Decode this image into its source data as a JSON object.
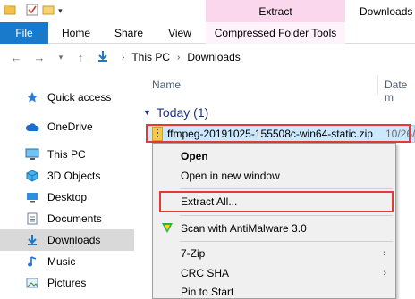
{
  "titlebar": {
    "context_group": "Extract",
    "window_title": "Downloads"
  },
  "ribbon": {
    "tabs": [
      "File",
      "Home",
      "Share",
      "View",
      "Compressed Folder Tools"
    ]
  },
  "address": {
    "crumbs": [
      "This PC",
      "Downloads"
    ]
  },
  "sidebar": {
    "items": [
      {
        "label": "Quick access",
        "icon": "star-icon"
      },
      {
        "label": "OneDrive",
        "icon": "cloud-icon"
      },
      {
        "label": "This PC",
        "icon": "computer-icon"
      },
      {
        "label": "3D Objects",
        "icon": "cube-icon"
      },
      {
        "label": "Desktop",
        "icon": "desktop-icon"
      },
      {
        "label": "Documents",
        "icon": "documents-icon"
      },
      {
        "label": "Downloads",
        "icon": "download-arrow-icon",
        "selected": true
      },
      {
        "label": "Music",
        "icon": "music-note-icon"
      },
      {
        "label": "Pictures",
        "icon": "pictures-icon"
      }
    ]
  },
  "main": {
    "columns": [
      "Name",
      "Date m"
    ],
    "group_label": "Today (1)",
    "file": {
      "name": "ffmpeg-20191025-155508c-win64-static.zip",
      "date": "10/26/"
    }
  },
  "context_menu": {
    "items": [
      {
        "label": "Open",
        "bold": true
      },
      {
        "label": "Open in new window"
      },
      {
        "label": "Extract All..."
      },
      {
        "label": "Scan with AntiMalware 3.0"
      },
      {
        "label": "7-Zip",
        "submenu": true
      },
      {
        "label": "CRC SHA",
        "submenu": true
      },
      {
        "label": "Pin to Start"
      }
    ]
  },
  "colors": {
    "file_tab": "#1979ca",
    "extract_tab": "#fbd7ee",
    "selection": "#cce8ff",
    "highlight_box": "#e53935",
    "group_text": "#1e3287"
  }
}
